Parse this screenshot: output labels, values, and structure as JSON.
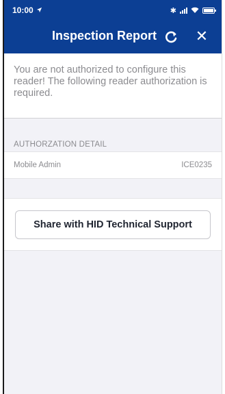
{
  "status_bar": {
    "time": "10:00",
    "bluetooth": "✱"
  },
  "nav": {
    "title": "Inspection Report",
    "close_label": "✕"
  },
  "message": "You are not authorized to configure this reader! The following reader authorization is required.",
  "section": {
    "header": "AUTHORZATION DETAIL",
    "rows": [
      {
        "label": "Mobile Admin",
        "value": "ICE0235"
      }
    ]
  },
  "share": {
    "label": "Share with HID Technical Support"
  },
  "colors": {
    "nav_blue": "#0c3f94",
    "background": "#f2f2f7",
    "muted_text": "#8b8b8f"
  }
}
